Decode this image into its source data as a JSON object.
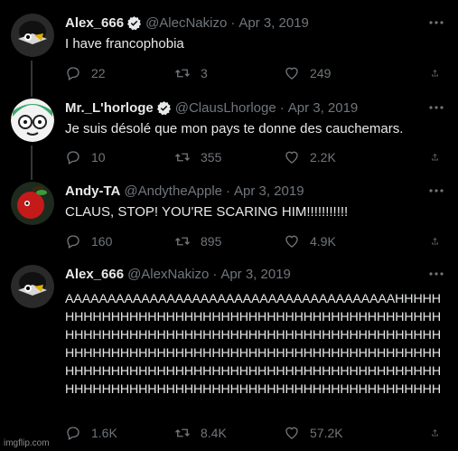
{
  "tweets": [
    {
      "name": "Alex_666",
      "verified": true,
      "handle": "@AlecNakizo",
      "dot": "·",
      "date": "Apr 3, 2019",
      "text": "I have francophobia",
      "replies": "22",
      "retweets": "3",
      "likes": "249",
      "avatar": "crow-character-avatar"
    },
    {
      "name": "Mr._L'horloge",
      "verified": true,
      "handle": "@ClausLhorloge",
      "dot": "·",
      "date": "Apr 3, 2019",
      "text": "Je suis désolé que mon pays te donne des cauchemars.",
      "replies": "10",
      "retweets": "355",
      "likes": "2.2K",
      "avatar": "green-hair-character-avatar"
    },
    {
      "name": "Andy-TA",
      "verified": false,
      "handle": "@AndytheApple",
      "dot": "·",
      "date": "Apr 3, 2019",
      "text": "CLAUS, STOP! YOU'RE SCARING HIM!!!!!!!!!!!",
      "replies": "160",
      "retweets": "895",
      "likes": "4.9K",
      "avatar": "apple-character-avatar"
    },
    {
      "name": "Alex_666",
      "verified": false,
      "handle": "@AlexNakizo",
      "dot": "·",
      "date": "Apr 3, 2019",
      "text": "AAAAAAAAAAAAAAAAAAAAAAAAAAAAAAAAAAAAAAAHHHHHHHHHHHHHHHHHHHHHHHHHHHHHHHHHHHHHHHHHHHHHHHHHHHHHHHHHHHHHHHHHHHHHHHHHHHHHHHHHHHHHHHHHHHHHHHHHHHHHHHHHHHHHHHHHHHHHHHHHHHHHHHHHHHHHHHHHHHHHHHHHHHHHHHHHHHHHHHHHHHHHHHHHHHHHHHHHHHHHHHHHHHHHHHHHHHHHHHHHHHHHHHHHH",
      "replies": "1.6K",
      "retweets": "8.4K",
      "likes": "57.2K",
      "avatar": "crow-character-avatar"
    }
  ],
  "watermark": "imgflip.com",
  "colors": {
    "background": "#000000",
    "text": "#e7e9ea",
    "secondary": "#71767b",
    "verified": "#1d9bf0"
  }
}
